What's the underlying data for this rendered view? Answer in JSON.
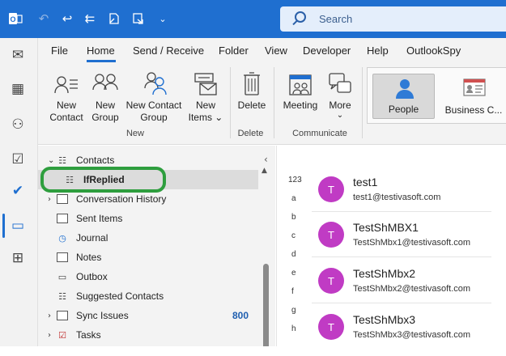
{
  "titlebar": {
    "search_placeholder": "Search",
    "icons": [
      "outlook-app-icon",
      "undo-icon",
      "reply-icon",
      "reply-all-icon",
      "forward-icon",
      "assign-icon",
      "customize-icon"
    ]
  },
  "rail": {
    "items": [
      {
        "name": "mail",
        "glyph": "✉"
      },
      {
        "name": "calendar",
        "glyph": "▦"
      },
      {
        "name": "people",
        "glyph": "⚇"
      },
      {
        "name": "tasks",
        "glyph": "☑"
      },
      {
        "name": "todo",
        "glyph": "✔"
      },
      {
        "name": "folders",
        "glyph": "▭"
      },
      {
        "name": "apps",
        "glyph": "⊞"
      }
    ]
  },
  "menu": {
    "tabs": [
      "File",
      "Home",
      "Send / Receive",
      "Folder",
      "View",
      "Developer",
      "Help",
      "OutlookSpy"
    ],
    "active": "Home"
  },
  "ribbon": {
    "new_contact": "New\nContact",
    "new_group": "New\nGroup",
    "new_contact_group": "New Contact\nGroup",
    "new_items": "New\nItems ⌄",
    "group_new": "New",
    "delete": "Delete",
    "group_delete": "Delete",
    "meeting": "Meeting",
    "more": "More",
    "more_chevron": "⌄",
    "group_communicate": "Communicate",
    "view_people": "People",
    "view_business_card": "Business C..."
  },
  "folders": {
    "items": [
      {
        "label": "Contacts",
        "chevron": "⌄",
        "icon": "contacts-icon",
        "glyph": "☷"
      },
      {
        "label": "IfReplied",
        "icon": "contacts-icon",
        "glyph": "☷",
        "selected": true
      },
      {
        "label": "Conversation History",
        "chevron": "›",
        "icon": "folder-icon"
      },
      {
        "label": "Sent Items",
        "icon": "folder-icon"
      },
      {
        "label": "Journal",
        "icon": "journal-icon",
        "glyph": "◷"
      },
      {
        "label": "Notes",
        "icon": "folder-icon"
      },
      {
        "label": "Outbox",
        "icon": "outbox-icon",
        "glyph": "▭"
      },
      {
        "label": "Suggested Contacts",
        "icon": "contacts-icon",
        "glyph": "☷"
      },
      {
        "label": "Sync Issues",
        "chevron": "›",
        "icon": "folder-icon",
        "count": "800"
      },
      {
        "label": "Tasks",
        "chevron": "›",
        "icon": "tasks-icon",
        "glyph": "☑"
      }
    ]
  },
  "index_letters": [
    "123",
    "a",
    "b",
    "c",
    "d",
    "e",
    "f",
    "g",
    "h"
  ],
  "contacts": [
    {
      "initial": "T",
      "name": "test1",
      "email": "test1@testivasoft.com"
    },
    {
      "initial": "T",
      "name": "TestShMBX1",
      "email": "TestShMbx1@testivasoft.com"
    },
    {
      "initial": "T",
      "name": "TestShMbx2",
      "email": "TestShMbx2@testivasoft.com"
    },
    {
      "initial": "T",
      "name": "TestShMbx3",
      "email": "TestShMbx3@testivasoft.com"
    }
  ],
  "colors": {
    "titlebar": "#1f6fd0",
    "avatar": "#c03bc4",
    "highlight": "#2e9e3e",
    "count": "#1f5fb0"
  }
}
